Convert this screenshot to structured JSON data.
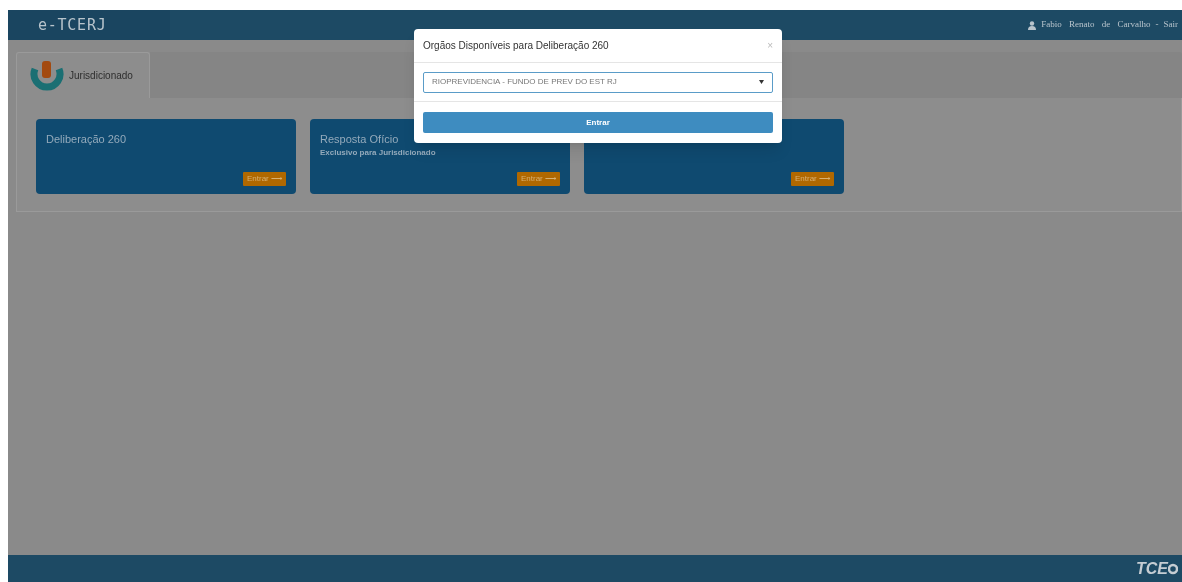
{
  "header": {
    "brand": "e-TCERJ",
    "user": "Fabio Renato de Carvalho",
    "separator": "-",
    "logout": "Sair"
  },
  "tabs": [
    {
      "label": "Jurisdicionado",
      "selected": true
    }
  ],
  "cards": [
    {
      "title": "Deliberação 260",
      "button": "Entrar ⟶"
    },
    {
      "title": "Resposta Ofício",
      "subtitle": "Exclusivo para Jurisdicionado",
      "button": "Entrar ⟶"
    },
    {
      "button": "Entrar ⟶"
    }
  ],
  "modal": {
    "title": "Orgãos Disponíveis para Deliberação 260",
    "close": "×",
    "select_value": "RIOPREVIDENCIA - FUNDO DE PREV DO EST RJ",
    "button": "Entrar"
  },
  "footer": {
    "logo": "TCE"
  }
}
